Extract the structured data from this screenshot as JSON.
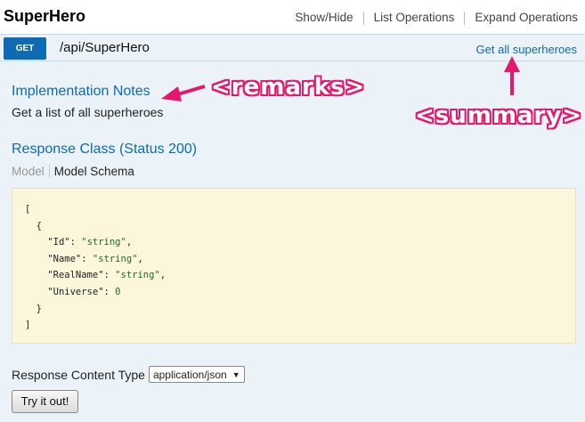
{
  "header": {
    "title": "SuperHero",
    "links": [
      "Show/Hide",
      "List Operations",
      "Expand Operations"
    ]
  },
  "operation": {
    "method": "GET",
    "path": "/api/SuperHero",
    "summary": "Get all superheroes"
  },
  "implementation": {
    "title": "Implementation Notes",
    "text": "Get a list of all superheroes"
  },
  "response": {
    "title": "Response Class (Status 200)",
    "tabs": [
      "Model",
      "Model Schema"
    ],
    "schema_lines": [
      "[",
      "  {",
      "    \"Id\": \"string\",",
      "    \"Name\": \"string\",",
      "    \"RealName\": \"string\",",
      "    \"Universe\": 0",
      "  }",
      "]"
    ]
  },
  "content_type": {
    "label": "Response Content Type",
    "selected": "application/json"
  },
  "try_button": "Try it out!",
  "annotations": {
    "remarks": "<remarks>",
    "summary": "<summary>",
    "color": "#e6176d"
  }
}
